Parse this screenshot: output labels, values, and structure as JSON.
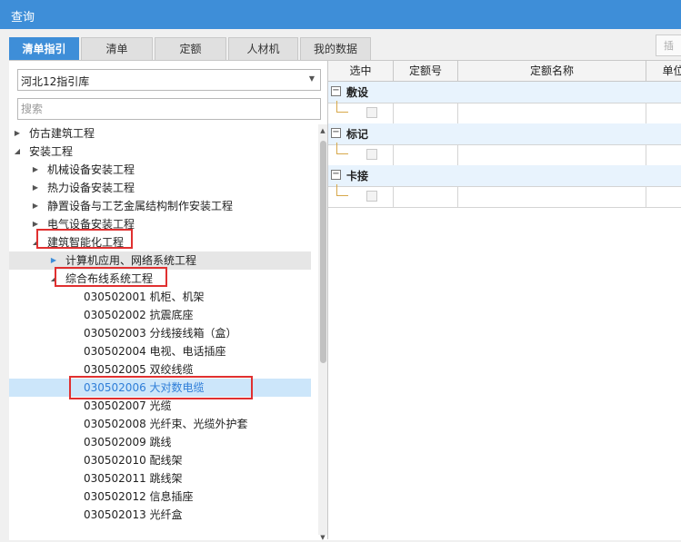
{
  "window": {
    "title": "查询"
  },
  "tabs": [
    {
      "label": "清单指引",
      "active": true
    },
    {
      "label": "清单",
      "active": false
    },
    {
      "label": "定额",
      "active": false
    },
    {
      "label": "人材机",
      "active": false
    },
    {
      "label": "我的数据",
      "active": false
    }
  ],
  "toolbar": {
    "insert_label": "插"
  },
  "library": {
    "selected": "河北12指引库"
  },
  "search": {
    "placeholder": "搜索"
  },
  "tree": [
    {
      "label": "仿古建筑工程",
      "state": "collapsed"
    },
    {
      "label": "安装工程",
      "state": "expanded"
    },
    {
      "label": "机械设备安装工程",
      "state": "collapsed"
    },
    {
      "label": "热力设备安装工程",
      "state": "collapsed"
    },
    {
      "label": "静置设备与工艺金属结构制作安装工程",
      "state": "collapsed"
    },
    {
      "label": "电气设备安装工程",
      "state": "collapsed"
    },
    {
      "label": "建筑智能化工程",
      "state": "expanded"
    },
    {
      "label": "计算机应用、网络系统工程",
      "state": "collapsed"
    },
    {
      "label": "综合布线系统工程",
      "state": "expanded"
    },
    {
      "label": "030502001  机柜、机架",
      "state": "leaf"
    },
    {
      "label": "030502002  抗震底座",
      "state": "leaf"
    },
    {
      "label": "030502003  分线接线箱（盒）",
      "state": "leaf"
    },
    {
      "label": "030502004  电视、电话插座",
      "state": "leaf"
    },
    {
      "label": "030502005  双绞线缆",
      "state": "leaf"
    },
    {
      "label": "030502006  大对数电缆",
      "state": "leaf"
    },
    {
      "label": "030502007  光缆",
      "state": "leaf"
    },
    {
      "label": "030502008  光纤束、光缆外护套",
      "state": "leaf"
    },
    {
      "label": "030502009  跳线",
      "state": "leaf"
    },
    {
      "label": "030502010  配线架",
      "state": "leaf"
    },
    {
      "label": "030502011  跳线架",
      "state": "leaf"
    },
    {
      "label": "030502012  信息插座",
      "state": "leaf"
    },
    {
      "label": "030502013  光纤盒",
      "state": "leaf"
    }
  ],
  "grid": {
    "columns": [
      "选中",
      "定额号",
      "定额名称",
      "单位"
    ],
    "groups": [
      {
        "name": "敷设",
        "expander": "−"
      },
      {
        "name": "标记",
        "expander": "−"
      },
      {
        "name": "卡接",
        "expander": "−"
      }
    ]
  },
  "colors": {
    "accent": "#3e8ed8",
    "highlight_red": "#e03030",
    "selected_row": "#cce6fa",
    "group_row": "#e8f3fd"
  }
}
